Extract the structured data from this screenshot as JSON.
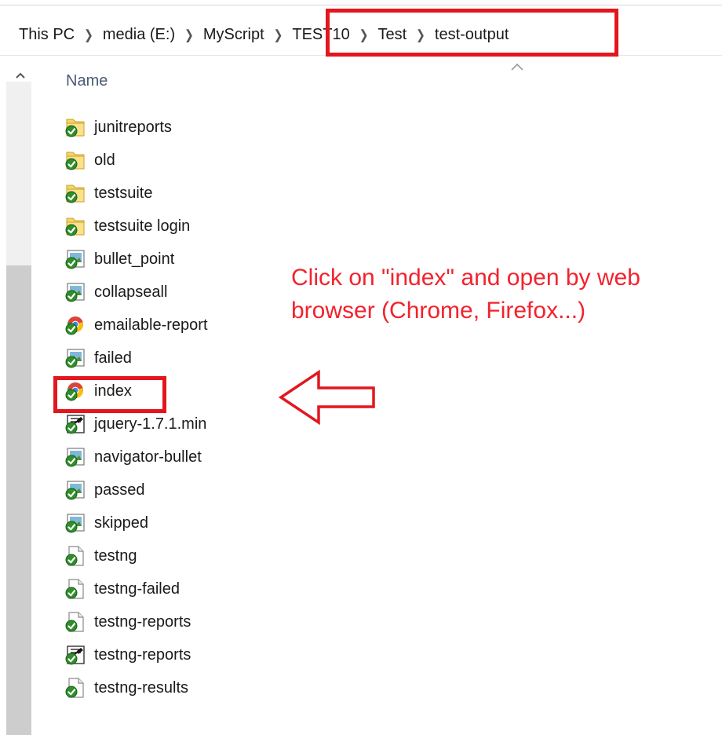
{
  "breadcrumb": [
    {
      "label": "This PC"
    },
    {
      "label": "media (E:)"
    },
    {
      "label": "MyScript"
    },
    {
      "label": "TEST10"
    },
    {
      "label": "Test"
    },
    {
      "label": "test-output"
    }
  ],
  "columns": {
    "name": "Name"
  },
  "files": [
    {
      "name": "junitreports",
      "icon": "folder-shared-icon"
    },
    {
      "name": "old",
      "icon": "folder-shared-icon"
    },
    {
      "name": "testsuite",
      "icon": "folder-shared-icon"
    },
    {
      "name": "testsuite login",
      "icon": "folder-shared-icon"
    },
    {
      "name": "bullet_point",
      "icon": "image-file-icon"
    },
    {
      "name": "collapseall",
      "icon": "image-file-icon"
    },
    {
      "name": "emailable-report",
      "icon": "chrome-html-file-icon"
    },
    {
      "name": "failed",
      "icon": "image-file-icon"
    },
    {
      "name": "index",
      "icon": "chrome-html-file-icon"
    },
    {
      "name": "jquery-1.7.1.min",
      "icon": "script-file-icon"
    },
    {
      "name": "navigator-bullet",
      "icon": "image-file-icon"
    },
    {
      "name": "passed",
      "icon": "image-file-icon"
    },
    {
      "name": "skipped",
      "icon": "image-file-icon"
    },
    {
      "name": "testng",
      "icon": "generic-file-icon"
    },
    {
      "name": "testng-failed",
      "icon": "generic-file-icon"
    },
    {
      "name": "testng-reports",
      "icon": "generic-file-icon"
    },
    {
      "name": "testng-reports",
      "icon": "script-file-icon"
    },
    {
      "name": "testng-results",
      "icon": "generic-file-icon"
    }
  ],
  "annotation": {
    "line1": "Click on \"index\" and open by web",
    "line2": "browser (Chrome, Firefox...)"
  },
  "colors": {
    "highlight": "#e3161e",
    "annotation": "#f2232e",
    "header_text": "#4a5a74"
  }
}
